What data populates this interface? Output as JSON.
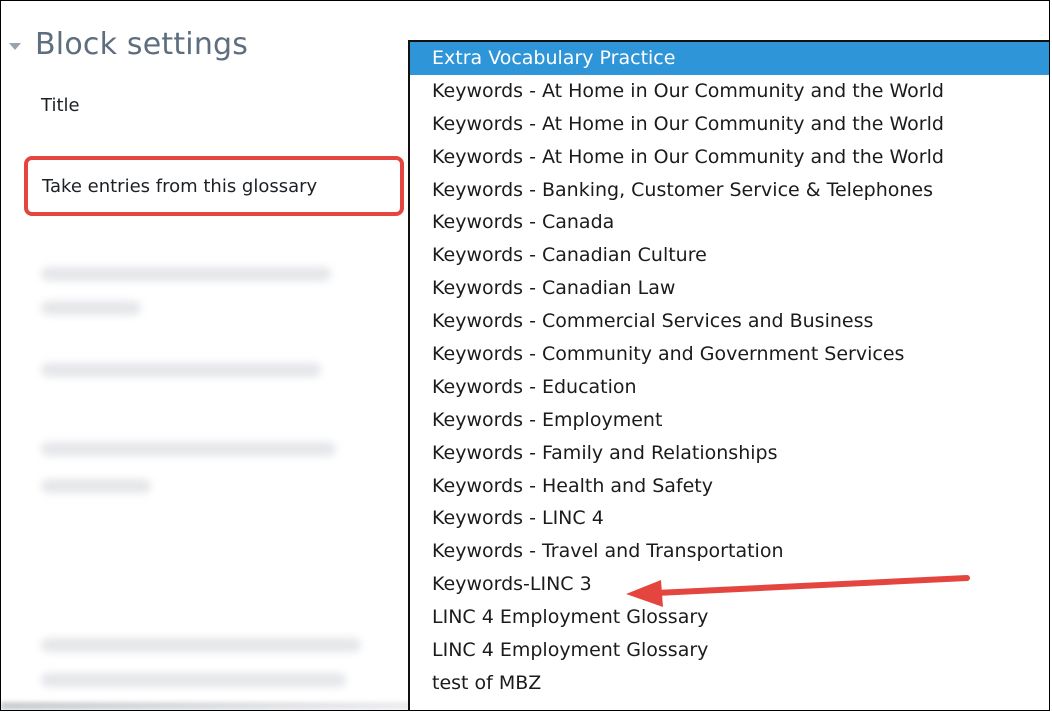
{
  "section": {
    "title": "Block settings"
  },
  "form": {
    "title_label": "Title",
    "glossary_label": "Take entries from this glossary"
  },
  "dropdown": {
    "selected_index": 0,
    "options": [
      "Extra Vocabulary Practice",
      "Keywords - At Home in Our Community and the World",
      "Keywords - At Home in Our Community and the World",
      "Keywords - At Home in Our Community and the World",
      "Keywords - Banking, Customer Service & Telephones",
      "Keywords - Canada",
      "Keywords - Canadian Culture",
      "Keywords - Canadian Law",
      "Keywords - Commercial Services and Business",
      "Keywords - Community and Government Services",
      "Keywords - Education",
      "Keywords - Employment",
      "Keywords - Family and Relationships",
      "Keywords - Health and Safety",
      "Keywords - LINC 4",
      "Keywords - Travel and Transportation",
      "Keywords-LINC 3",
      "LINC 4 Employment Glossary",
      "LINC 4 Employment Glossary",
      "test of MBZ"
    ]
  },
  "colors": {
    "highlight": "#e4463f",
    "selected_bg": "#2f95d9",
    "arrow": "#e4463f"
  }
}
